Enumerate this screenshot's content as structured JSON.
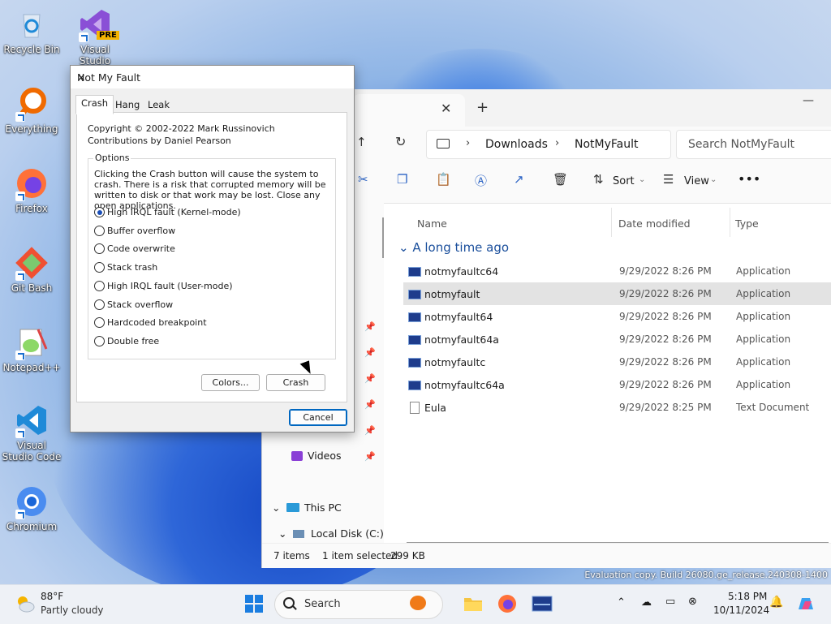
{
  "desktop": {
    "icons": [
      {
        "label": "Recycle Bin"
      },
      {
        "label": "Visual Studio",
        "badge": "PRE"
      },
      {
        "label": "Everything"
      },
      {
        "label": "Firefox"
      },
      {
        "label": "Git Bash"
      },
      {
        "label": "Notepad++"
      },
      {
        "label": "Visual Studio Code"
      },
      {
        "label": "Chromium"
      }
    ],
    "evaluation_text": "Evaluation copy. Build 26080.ge_release.240308-1400"
  },
  "explorer": {
    "breadcrumb": [
      "Downloads",
      "NotMyFault"
    ],
    "search_placeholder": "Search NotMyFault",
    "sort_label": "Sort",
    "view_label": "View",
    "columns": {
      "name": "Name",
      "date": "Date modified",
      "type": "Type"
    },
    "group_label": "A long time ago",
    "files": [
      {
        "name": "notmyfaultc64",
        "date": "9/29/2022 8:26 PM",
        "type": "Application",
        "icon": "app-icon"
      },
      {
        "name": "notmyfault",
        "date": "9/29/2022 8:26 PM",
        "type": "Application",
        "icon": "app-icon",
        "selected": true
      },
      {
        "name": "notmyfault64",
        "date": "9/29/2022 8:26 PM",
        "type": "Application",
        "icon": "app-icon"
      },
      {
        "name": "notmyfault64a",
        "date": "9/29/2022 8:26 PM",
        "type": "Application",
        "icon": "app-icon"
      },
      {
        "name": "notmyfaultc",
        "date": "9/29/2022 8:26 PM",
        "type": "Application",
        "icon": "app-icon"
      },
      {
        "name": "notmyfaultc64a",
        "date": "9/29/2022 8:26 PM",
        "type": "Application",
        "icon": "app-icon"
      },
      {
        "name": "Eula",
        "date": "9/29/2022 8:25 PM",
        "type": "Text Document",
        "icon": "document-icon"
      }
    ],
    "nav": {
      "videos": "Videos",
      "this_pc": "This PC",
      "local_disk": "Local Disk (C:)"
    },
    "status": {
      "count": "7 items",
      "selected": "1 item selected",
      "size": "299 KB"
    }
  },
  "dialog": {
    "title": "Not My Fault",
    "tabs": [
      "Crash",
      "Hang",
      "Leak"
    ],
    "copyright": "Copyright © 2002-2022 Mark Russinovich",
    "contributions": "Contributions by Daniel Pearson",
    "options_label": "Options",
    "description": "Clicking the Crash button will cause the system to crash. There is a risk that corrupted memory will be written to disk or that work may be lost. Close any open applications.",
    "options": [
      "High IRQL fault (Kernel-mode)",
      "Buffer overflow",
      "Code overwrite",
      "Stack trash",
      "High IRQL fault (User-mode)",
      "Stack overflow",
      "Hardcoded breakpoint",
      "Double free"
    ],
    "selected_option": 0,
    "buttons": {
      "colors": "Colors...",
      "crash": "Crash",
      "cancel": "Cancel"
    }
  },
  "taskbar": {
    "weather_temp": "88°F",
    "weather_condition": "Partly cloudy",
    "search_label": "Search",
    "time": "5:18 PM",
    "date": "10/11/2024"
  }
}
